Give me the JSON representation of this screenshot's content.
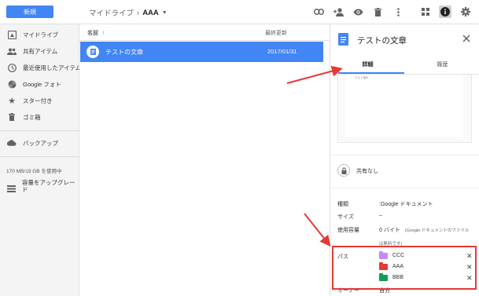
{
  "topbar": {
    "new_label": "新規",
    "breadcrumb_root": "マイドライブ",
    "breadcrumb_sep": "›",
    "breadcrumb_current": "AAA",
    "icons": [
      "link-icon",
      "add-person-icon",
      "eye-icon",
      "trash-icon",
      "more-vert-icon",
      "grid-view-icon",
      "info-icon",
      "settings-icon"
    ]
  },
  "sidebar": {
    "items": [
      {
        "label": "マイドライブ",
        "icon": "drive-icon"
      },
      {
        "label": "共有アイテム",
        "icon": "people-icon"
      },
      {
        "label": "最近使用したアイテム",
        "icon": "clock-icon"
      },
      {
        "label": "Google フォト",
        "icon": "photos-icon"
      },
      {
        "label": "スター付き",
        "icon": "star-icon"
      },
      {
        "label": "ゴミ箱",
        "icon": "trash-icon"
      }
    ],
    "backup": {
      "label": "バックアップ",
      "icon": "cloud-icon"
    },
    "storage": "170 MB/19 GB を使用中",
    "upgrade": "容量をアップグレード"
  },
  "file_list": {
    "header_name": "名前",
    "sort_arrow": "↑",
    "header_date": "最終更新",
    "rows": [
      {
        "name": "テストの文章",
        "date": "2017/01/31",
        "selected": true
      }
    ]
  },
  "details": {
    "title": "テストの文章",
    "tabs": [
      {
        "label": "詳細"
      },
      {
        "label": "履歴"
      }
    ],
    "preview_text": "テスト用の",
    "sharing": "共有なし",
    "props": {
      "type_key": "種類",
      "type_val": ":Google ドキュメント",
      "size_key": "サイズ",
      "size_val": "–",
      "used_key": "使用容量",
      "used_val": "0 バイト",
      "used_note": "(Google ドキュメントのファイル",
      "used_note2": "は無料です)",
      "path_key": "パス",
      "owner_key": "オーナー",
      "owner_val": "自分"
    },
    "paths": [
      {
        "name": "CCC",
        "color": "#c58af9"
      },
      {
        "name": "AAA",
        "color": "#e53935"
      },
      {
        "name": "BBB",
        "color": "#0f9d58"
      }
    ]
  },
  "colors": {
    "accent": "#4285f4",
    "annotation": "#e53935"
  }
}
